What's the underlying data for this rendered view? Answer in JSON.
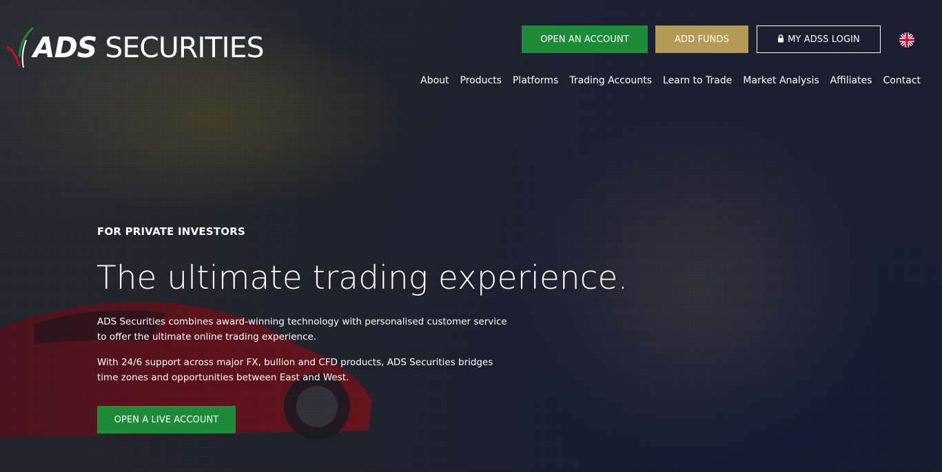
{
  "brand": {
    "logo_text_ads": "ADS",
    "logo_text_rest": " SECURITIES"
  },
  "header": {
    "open_account_label": "OPEN AN ACCOUNT",
    "add_funds_label": "ADD FUNDS",
    "login_label": "MY ADSS LOGIN",
    "language_icon": "uk-flag-icon"
  },
  "nav": {
    "items": [
      {
        "label": "About"
      },
      {
        "label": "Products"
      },
      {
        "label": "Platforms"
      },
      {
        "label": "Trading Accounts"
      },
      {
        "label": "Learn to Trade"
      },
      {
        "label": "Market Analysis"
      },
      {
        "label": "Affiliates"
      },
      {
        "label": "Contact"
      }
    ]
  },
  "hero": {
    "eyebrow": "FOR PRIVATE INVESTORS",
    "headline": "The ultimate trading experience.",
    "paragraph1": "ADS Securities combines award-winning technology with personalised customer service to offer the ultimate online trading experience.",
    "paragraph2": "With 24/6 support across major FX, bullion and CFD products, ADS Securities bridges time zones and opportunities between East and West.",
    "cta_label": "OPEN A LIVE ACCOUNT"
  },
  "colors": {
    "green": "#1d8b3a",
    "gold": "#b39a55"
  }
}
